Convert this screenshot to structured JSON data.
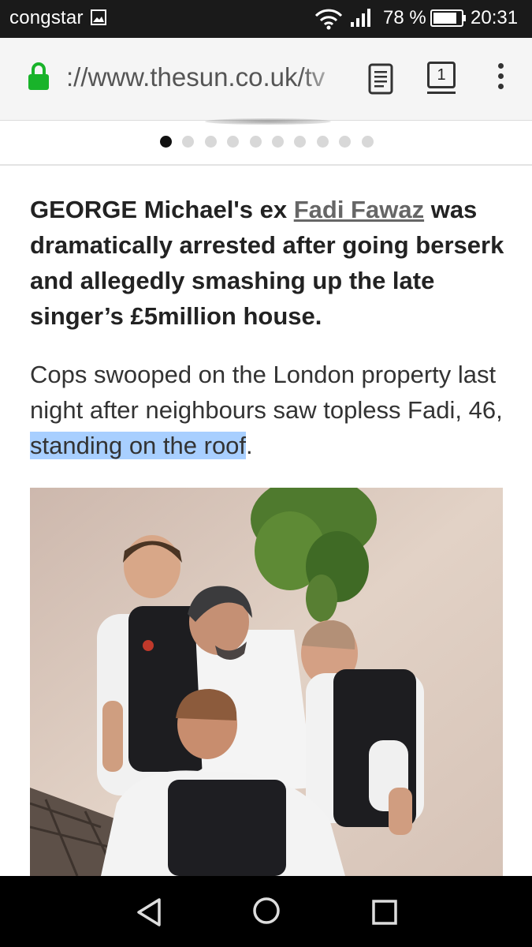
{
  "status_bar": {
    "carrier": "congstar",
    "battery_percent": "78 %",
    "time": "20:31",
    "icons": [
      "image-icon",
      "wifi-icon",
      "signal-icon",
      "battery-icon"
    ]
  },
  "browser": {
    "url": "://www.thesun.co.uk/tv",
    "tab_count": "1",
    "icons": [
      "lock-icon",
      "reader-mode-icon",
      "tabs-icon",
      "overflow-menu-icon"
    ],
    "lock_color": "#19b32a"
  },
  "carousel": {
    "total_slides": 10,
    "active_index": 0
  },
  "article": {
    "lead_before": "GEORGE Michael's ex ",
    "lead_link": "Fadi Fawaz",
    "lead_after": " was dramatically arrested after going berserk and allegedly smashing up the late singer’s £5million house.",
    "para_before": "Cops swooped on the London property last night after neighbours saw topless Fadi, 46, ",
    "para_highlight": "standing on the roof",
    "para_after": ".",
    "highlight_color": "#a8cfff"
  },
  "nav_bar": {
    "icons": [
      "back-icon",
      "home-icon",
      "recents-icon"
    ]
  }
}
